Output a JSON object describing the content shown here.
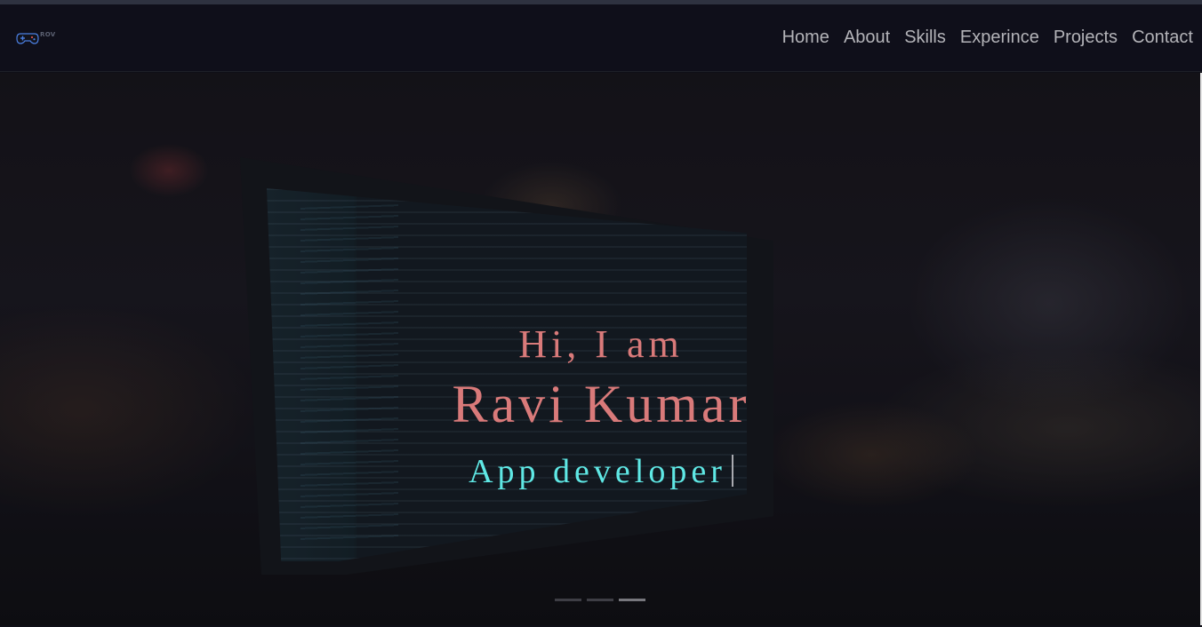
{
  "logo": {
    "text": "ROV",
    "icon": "gamepad-icon"
  },
  "nav": {
    "items": [
      {
        "label": "Home"
      },
      {
        "label": "About"
      },
      {
        "label": "Skills"
      },
      {
        "label": "Experince"
      },
      {
        "label": "Projects"
      },
      {
        "label": "Contact"
      }
    ]
  },
  "hero": {
    "greeting": "Hi, I am",
    "name": "Ravi Kumar",
    "role": "App developer",
    "slides": {
      "count": 3,
      "active_index": 2
    }
  },
  "colors": {
    "navbar_bg": "#0f0f1a",
    "nav_text": "#b3b3b8",
    "accent_name": "#d97a7a",
    "accent_role": "#5fe8e5"
  }
}
